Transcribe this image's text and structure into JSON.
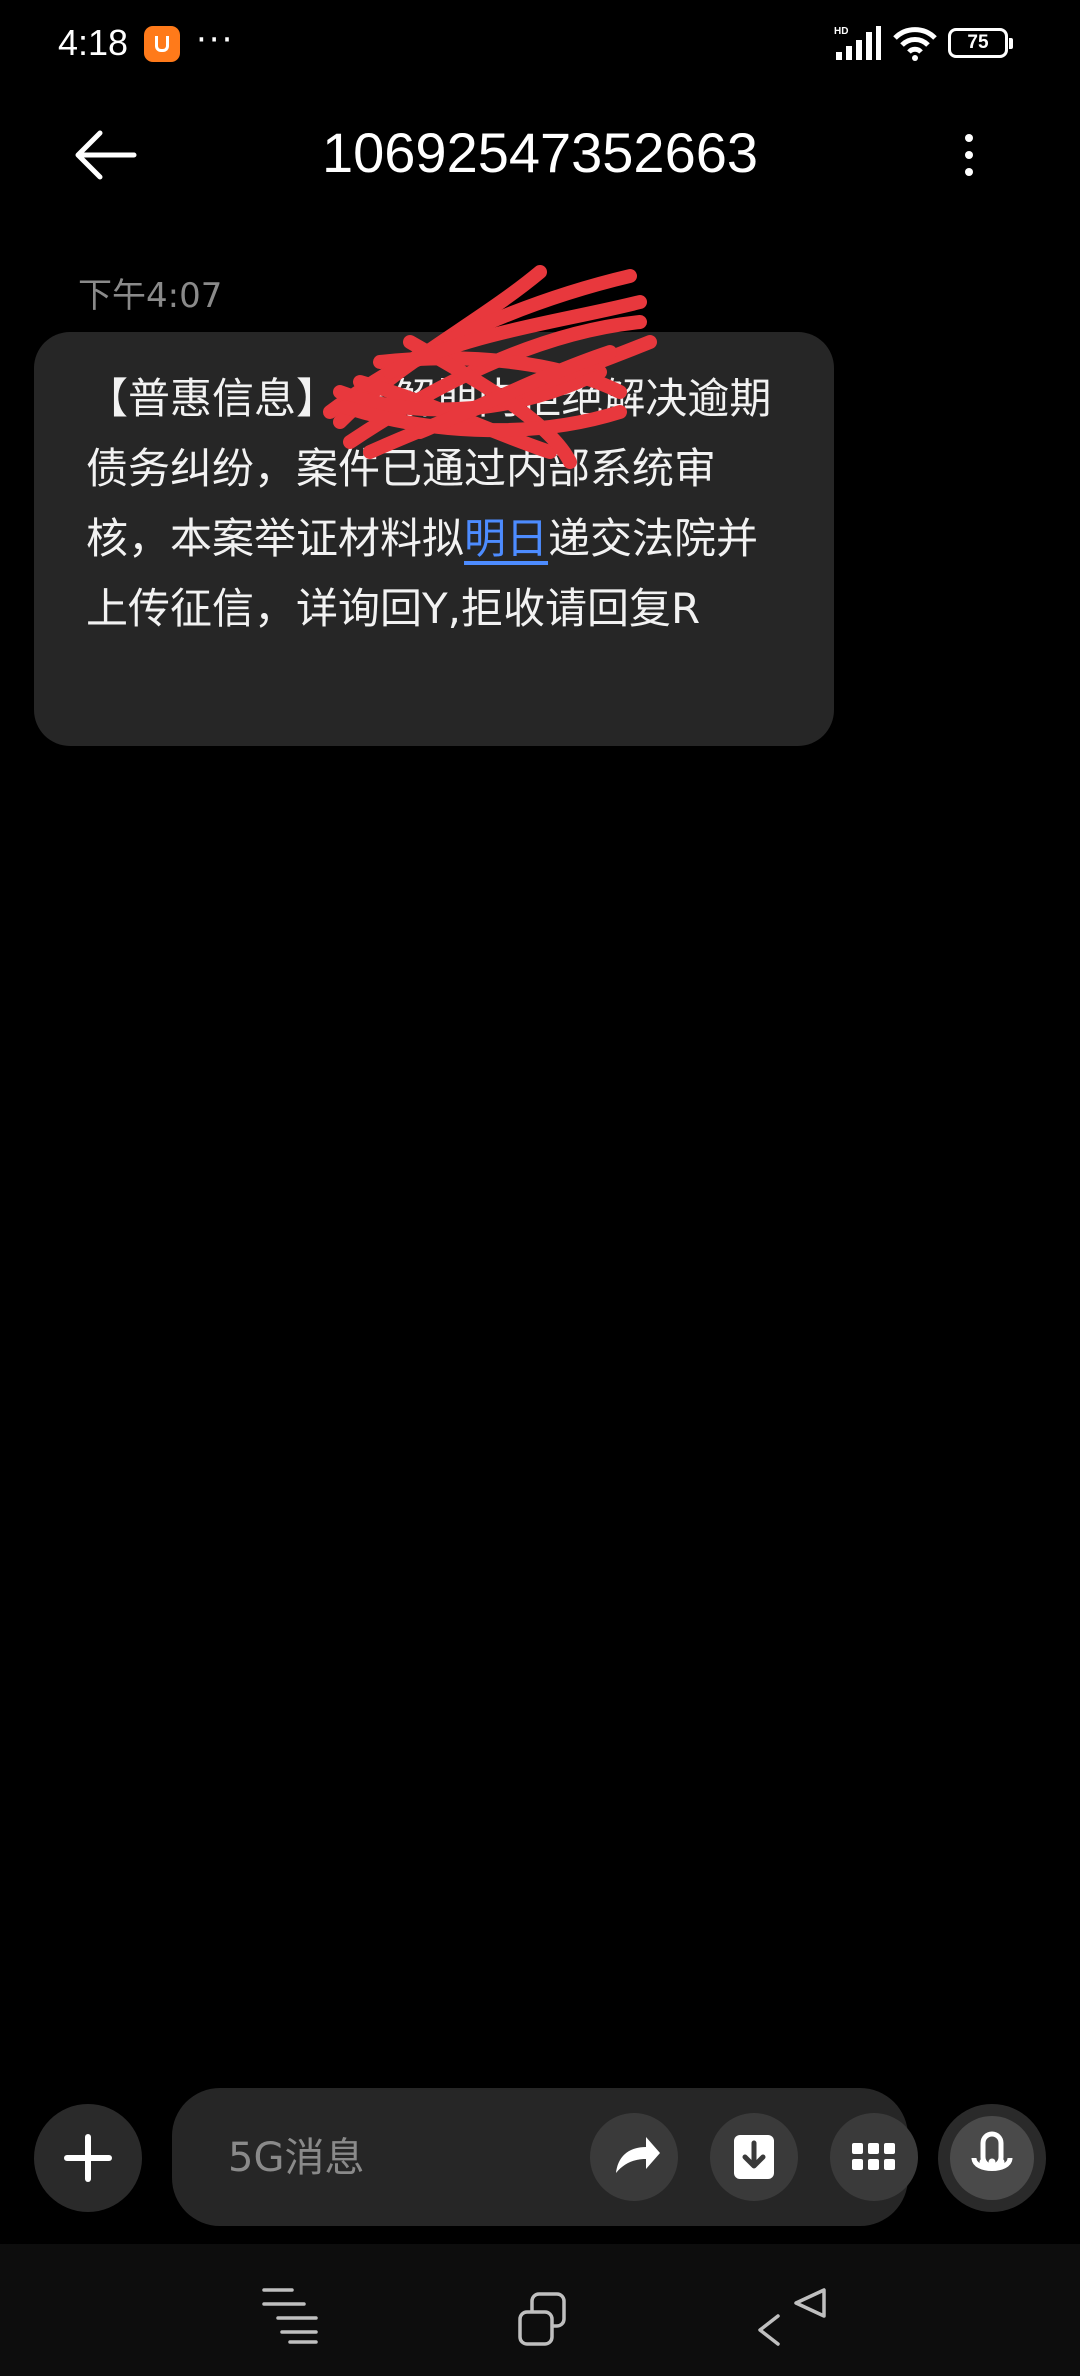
{
  "status_bar": {
    "time": "4:18",
    "overflow_dots": "···",
    "network_label": "HD",
    "battery_level": "75"
  },
  "header": {
    "title": "10692547352663"
  },
  "message": {
    "timestamp": "下午4:07",
    "text_before_link": "【普惠信息】        调解期内拒绝解决逾期债务纠纷，案件已通过内部系统审核，本案举证材料拟",
    "link_text": "明日",
    "text_after_link": "递交法院并上传征信，详询回Y,拒收请回复R"
  },
  "composer": {
    "placeholder": "5G消息"
  },
  "colors": {
    "background": "#000000",
    "bubble": "#262626",
    "link": "#4d8cff",
    "scribble": "#e8383d"
  }
}
